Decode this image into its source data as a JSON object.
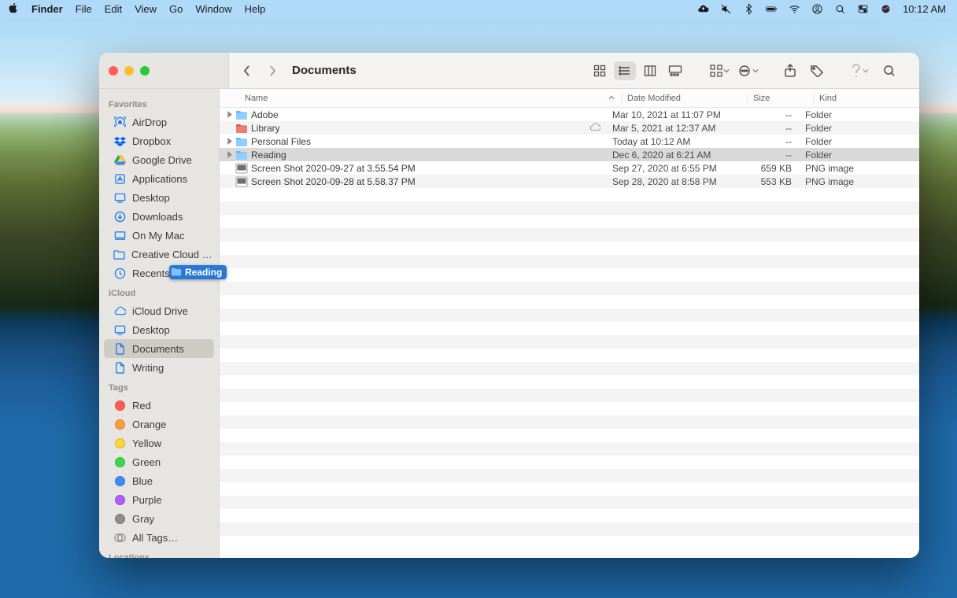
{
  "menubar": {
    "app": "Finder",
    "items": [
      "File",
      "Edit",
      "View",
      "Go",
      "Window",
      "Help"
    ],
    "clock": "10:12 AM"
  },
  "finder": {
    "title": "Documents",
    "columns": {
      "name": "Name",
      "date": "Date Modified",
      "size": "Size",
      "kind": "Kind"
    },
    "rows": [
      {
        "disclosure": true,
        "icon": "folder",
        "name": "Adobe",
        "date": "Mar 10, 2021 at 11:07 PM",
        "size": "--",
        "kind": "Folder"
      },
      {
        "disclosure": false,
        "icon": "folder-red",
        "name": "Library",
        "cloud": true,
        "date": "Mar 5, 2021 at 12:37 AM",
        "size": "--",
        "kind": "Folder"
      },
      {
        "disclosure": true,
        "icon": "folder",
        "name": "Personal Files",
        "date": "Today at 10:12 AM",
        "size": "--",
        "kind": "Folder"
      },
      {
        "disclosure": true,
        "icon": "folder",
        "name": "Reading",
        "selected": true,
        "date": "Dec 6, 2020 at 6:21 AM",
        "size": "--",
        "kind": "Folder"
      },
      {
        "disclosure": false,
        "icon": "image",
        "name": "Screen Shot 2020-09-27 at 3.55.54 PM",
        "date": "Sep 27, 2020 at 6:55 PM",
        "size": "659 KB",
        "kind": "PNG image"
      },
      {
        "disclosure": false,
        "icon": "image",
        "name": "Screen Shot 2020-09-28 at 5.58.37 PM",
        "date": "Sep 28, 2020 at 8:58 PM",
        "size": "553 KB",
        "kind": "PNG image"
      }
    ]
  },
  "sidebar": {
    "favorites_header": "Favorites",
    "favorites": [
      {
        "icon": "airdrop",
        "label": "AirDrop"
      },
      {
        "icon": "dropbox",
        "label": "Dropbox"
      },
      {
        "icon": "gdrive",
        "label": "Google Drive"
      },
      {
        "icon": "apps",
        "label": "Applications"
      },
      {
        "icon": "desktop",
        "label": "Desktop"
      },
      {
        "icon": "downloads",
        "label": "Downloads"
      },
      {
        "icon": "mac",
        "label": "On My Mac"
      },
      {
        "icon": "folder",
        "label": "Creative Cloud Files"
      },
      {
        "icon": "recents",
        "label": "Recents"
      }
    ],
    "icloud_header": "iCloud",
    "icloud": [
      {
        "icon": "cloud",
        "label": "iCloud Drive"
      },
      {
        "icon": "desktop",
        "label": "Desktop"
      },
      {
        "icon": "doc",
        "label": "Documents",
        "selected": true
      },
      {
        "icon": "doc",
        "label": "Writing"
      }
    ],
    "tags_header": "Tags",
    "tags": [
      {
        "color": "#ff5b51",
        "label": "Red"
      },
      {
        "color": "#ff9b3b",
        "label": "Orange"
      },
      {
        "color": "#ffd33b",
        "label": "Yellow"
      },
      {
        "color": "#3bd54e",
        "label": "Green"
      },
      {
        "color": "#3b8bff",
        "label": "Blue"
      },
      {
        "color": "#b25bff",
        "label": "Purple"
      },
      {
        "color": "#8d8d8d",
        "label": "Gray"
      }
    ],
    "all_tags": "All Tags…",
    "locations_header": "Locations"
  },
  "drag": {
    "label": "Reading"
  }
}
